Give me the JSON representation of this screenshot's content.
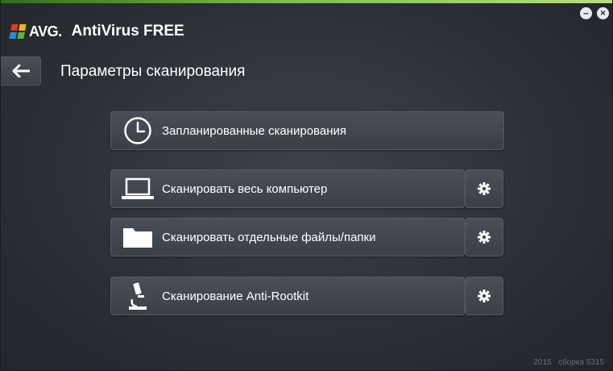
{
  "window": {
    "minimize_glyph": "–",
    "close_glyph": "×"
  },
  "brand": {
    "logo_text": "AVG.",
    "product": "AntiVirus FREE"
  },
  "header": {
    "title": "Параметры сканирования"
  },
  "scan_options": [
    {
      "label": "Запланированные сканирования",
      "icon": "clock-icon",
      "has_settings": false
    },
    {
      "label": "Сканировать весь компьютер",
      "icon": "laptop-icon",
      "has_settings": true
    },
    {
      "label": "Сканировать отдельные файлы/папки",
      "icon": "folder-icon",
      "has_settings": true
    },
    {
      "label": "Сканирование Anti-Rootkit",
      "icon": "microscope-icon",
      "has_settings": true
    }
  ],
  "footer": {
    "build": "2015   сборка 5315"
  },
  "colors": {
    "accent_green": "#7ac043",
    "background": "#2c3037"
  }
}
